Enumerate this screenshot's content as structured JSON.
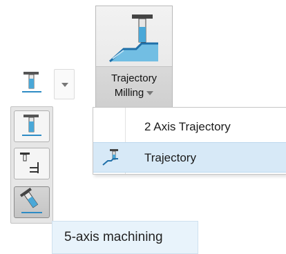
{
  "ribbon_button": {
    "label_line1": "Trajectory",
    "label_line2": "Milling",
    "icon": "trajectory-milling-icon"
  },
  "menu": {
    "items": [
      {
        "label": "2 Axis Trajectory",
        "icon": ""
      },
      {
        "label": "Trajectory",
        "icon": "trajectory-icon",
        "highlighted": true
      }
    ]
  },
  "tool_dropdown": {
    "current_icon": "end-mill-icon",
    "arrow_icon": "chevron-down-icon",
    "options": [
      {
        "icon": "end-mill-icon"
      },
      {
        "icon": "plunge-tool-icon"
      },
      {
        "icon": "five-axis-tool-icon",
        "active": true
      }
    ]
  },
  "tooltip": {
    "text": "5-axis machining"
  },
  "colors": {
    "highlight": "#d7e9f7",
    "tooltip_bg": "#e8f3fb",
    "tool_blue": "#4aa8d8"
  }
}
